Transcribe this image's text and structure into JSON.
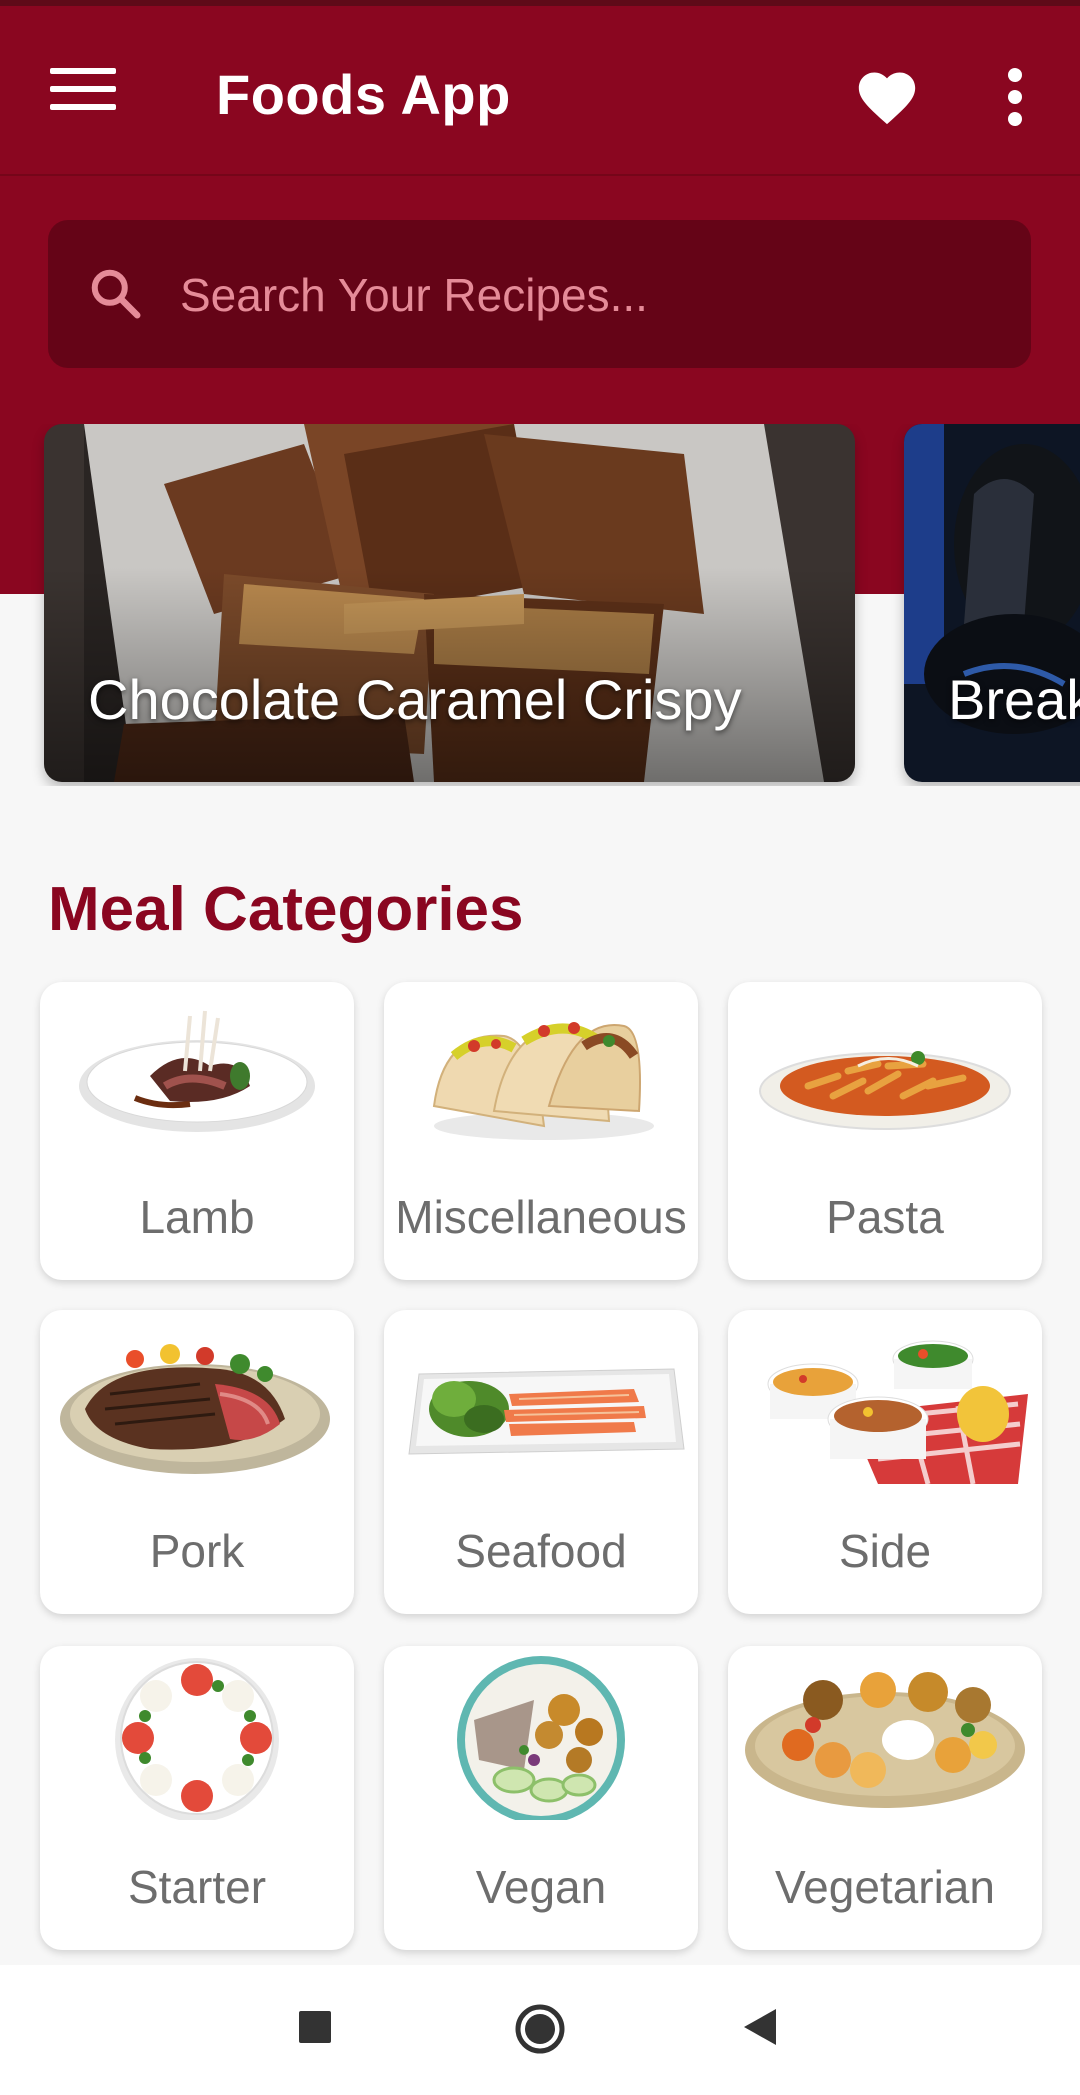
{
  "app": {
    "title": "Foods App"
  },
  "search": {
    "placeholder": "Search Your Recipes..."
  },
  "carousel": [
    {
      "title": "Chocolate Caramel Crispy"
    },
    {
      "title": "Break"
    }
  ],
  "section": {
    "title": "Meal Categories"
  },
  "categories": [
    {
      "label": "Lamb"
    },
    {
      "label": "Miscellaneous"
    },
    {
      "label": "Pasta"
    },
    {
      "label": "Pork"
    },
    {
      "label": "Seafood"
    },
    {
      "label": "Side"
    },
    {
      "label": "Starter"
    },
    {
      "label": "Vegan"
    },
    {
      "label": "Vegetarian"
    }
  ],
  "icons": {
    "menu": "menu-icon",
    "favorite": "heart-icon",
    "more": "more-vert-icon",
    "search": "search-icon",
    "nav_recents": "square-icon",
    "nav_home": "circle-icon",
    "nav_back": "triangle-back-icon"
  },
  "colors": {
    "primary": "#8a0620",
    "search_bg": "#650417",
    "accent_text": "#8a0620"
  }
}
